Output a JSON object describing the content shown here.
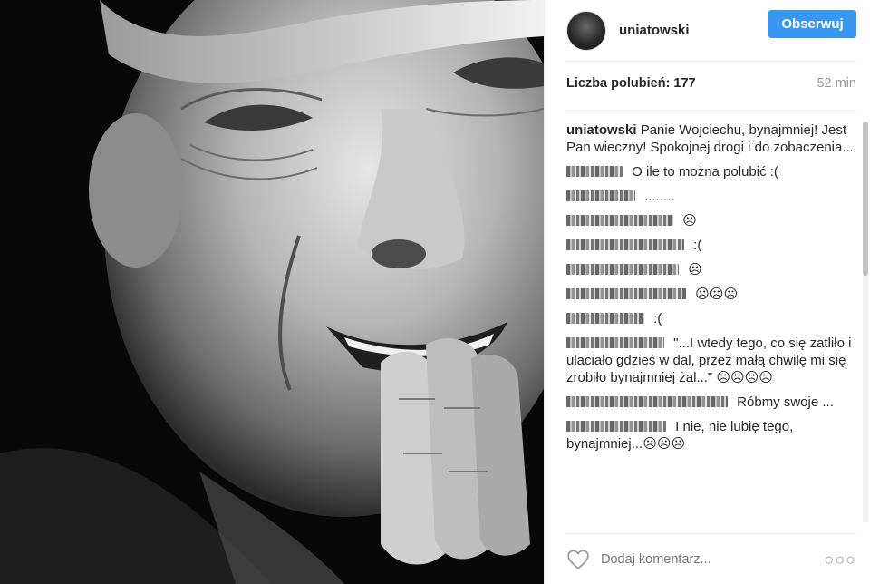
{
  "post": {
    "username": "uniatowski",
    "follow_label": "Obserwuj",
    "likes_text": "Liczba polubień: 177",
    "time_ago": "52 min"
  },
  "comments": [
    {
      "author": "uniatowski",
      "text": "Panie Wojciechu, bynajmniej! Jest Pan wieczny! Spokojnej drogi i do zobaczenia...",
      "redacted": false
    },
    {
      "text": "O ile to można polubić :(",
      "redacted": true
    },
    {
      "text": "........",
      "redacted": true
    },
    {
      "text": "☹",
      "redacted": true
    },
    {
      "text": ":(",
      "redacted": true
    },
    {
      "text": "☹",
      "redacted": true
    },
    {
      "text": "☹☹☹",
      "redacted": true
    },
    {
      "text": ":(",
      "redacted": true
    },
    {
      "text": "\"...I wtedy tego, co się zatliło i ulaciało gdzieś w dal, przez małą chwilę mi się zrobiło bynajmniej żal...\" ☹☹☹☹",
      "redacted": true
    },
    {
      "text": "Róbmy swoje ...",
      "redacted": true
    },
    {
      "text": "I nie, nie lubię tego, bynajmniej...☹☹☹",
      "redacted": true
    }
  ],
  "footer": {
    "comment_placeholder": "Dodaj komentarz...",
    "more_icon": "more-dots-icon",
    "like_icon": "heart-icon"
  },
  "colors": {
    "accent": "#3897f0",
    "text": "#262626",
    "muted": "#999999"
  }
}
